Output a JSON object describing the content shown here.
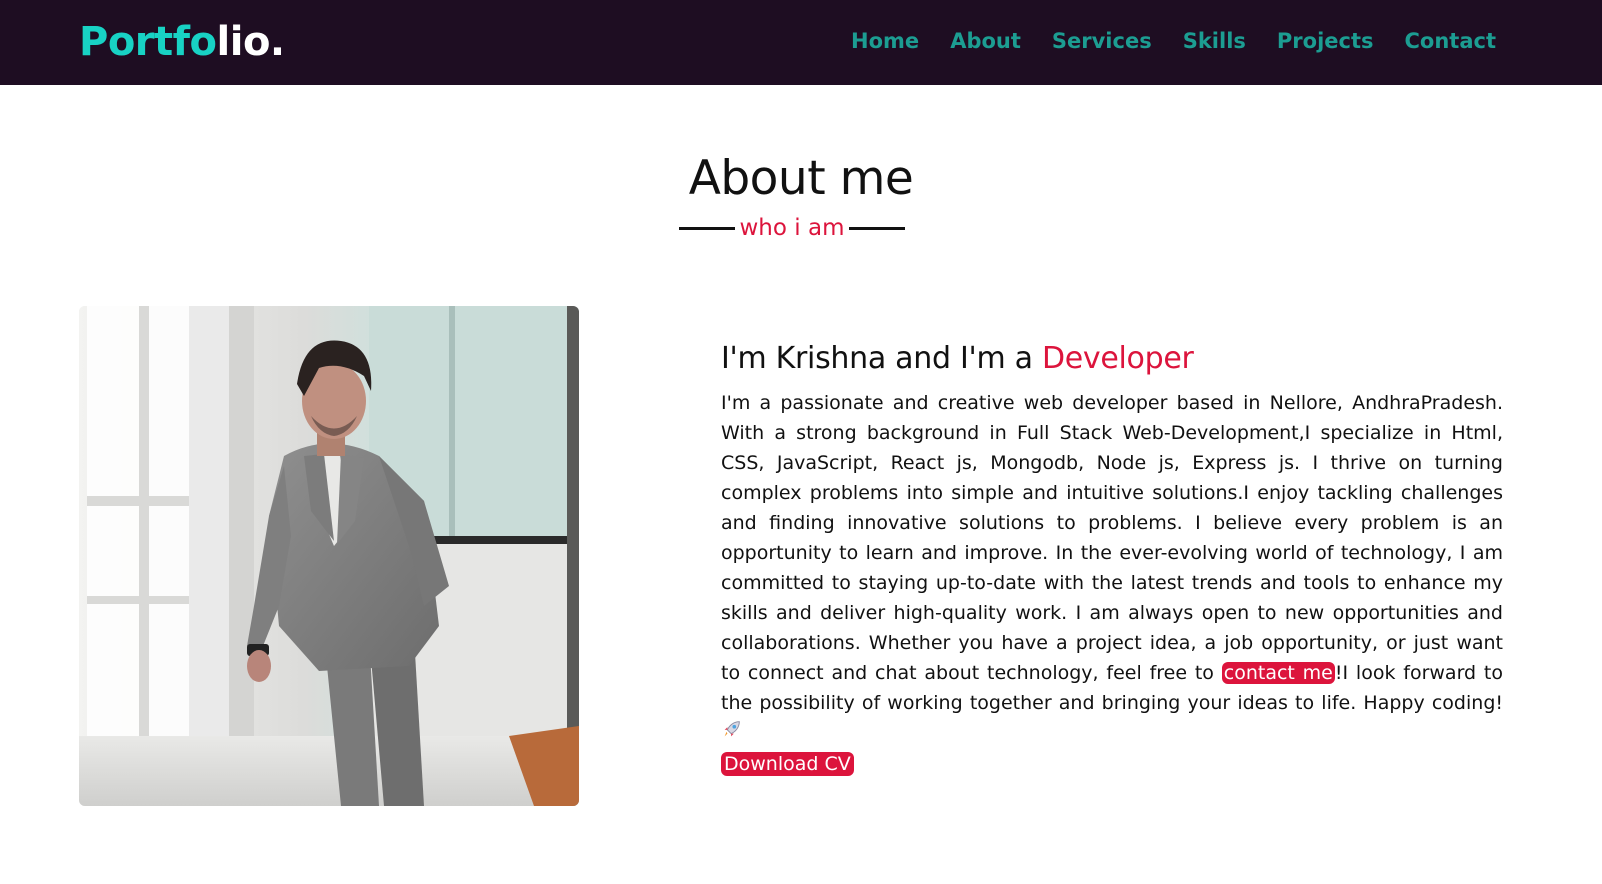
{
  "navbar": {
    "logo_part1": "Portfo",
    "logo_part2": "lio.",
    "items": [
      {
        "label": "Home"
      },
      {
        "label": "About"
      },
      {
        "label": "Services"
      },
      {
        "label": "Skills"
      },
      {
        "label": "Projects"
      },
      {
        "label": "Contact"
      }
    ]
  },
  "about": {
    "title": "About me",
    "subtitle": "who i am",
    "heading_prefix": "I'm Krishna and I'm a ",
    "heading_accent": "Developer",
    "paragraph_before_link": "I'm a passionate and creative web developer based in Nellore, AndhraPradesh. With a strong background in Full Stack Web-Development,I specialize in Html, CSS, JavaScript, React js, Mongodb, Node js, Express js. I thrive on turning complex problems into simple and intuitive solutions.I enjoy tackling challenges and finding innovative solutions to problems. I believe every problem is an opportunity to learn and improve. In the ever-evolving world of technology, I am committed to staying up-to-date with the latest trends and tools to enhance my skills and deliver high-quality work. I am always open to new opportunities and collaborations. Whether you have a project idea, a job opportunity, or just want to connect and chat about technology, feel free to ",
    "contact_link": "contact me",
    "paragraph_after_link": "!I look forward to the possibility of working together and bringing your ideas to life. Happy coding! ",
    "download_label": "Download CV",
    "photo_icon": "profile-photo",
    "rocket_icon": "rocket-icon"
  },
  "colors": {
    "navbar_bg": "#1e0d22",
    "logo_teal": "#18d2c4",
    "nav_link": "#1c9d92",
    "accent_red": "#dc143c"
  }
}
